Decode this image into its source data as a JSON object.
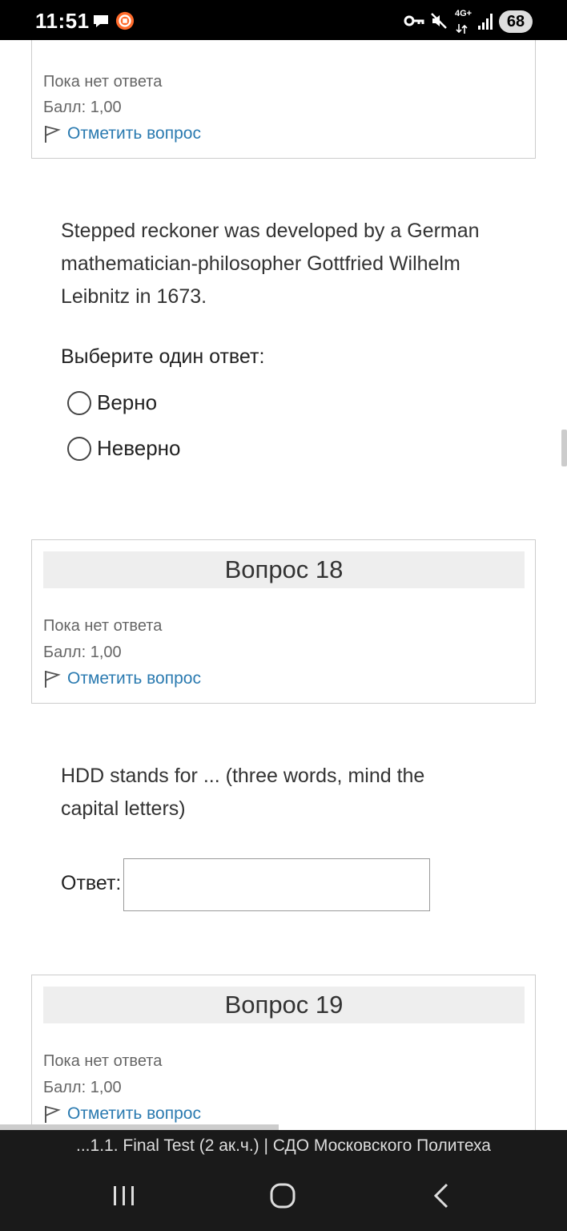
{
  "status_bar": {
    "time": "11:51",
    "network": "4G+",
    "battery": "68"
  },
  "question_17": {
    "state": "Пока нет ответа",
    "score": "Балл: 1,00",
    "flag_label": "Отметить вопрос",
    "text": "Stepped reckoner was developed by a German mathematician-philosopher Gottfried Wilhelm Leibnitz in 1673.",
    "prompt": "Выберите один ответ:",
    "options": [
      "Верно",
      "Неверно"
    ]
  },
  "question_18": {
    "title": "Вопрос 18",
    "state": "Пока нет ответа",
    "score": "Балл: 1,00",
    "flag_label": "Отметить вопрос",
    "text": "HDD stands for ... (three words, mind the capital letters)",
    "answer_label": "Ответ:",
    "answer_value": ""
  },
  "question_19": {
    "title": "Вопрос 19",
    "state": "Пока нет ответа",
    "score": "Балл: 1,00",
    "flag_label": "Отметить вопрос"
  },
  "browser": {
    "page_title": "...1.1. Final Test (2 ак.ч.) | СДО Московского Политеха"
  },
  "colors": {
    "link": "#2a7ab0",
    "status_bar": "#000000",
    "bottom_bar": "#1a1a1a"
  }
}
